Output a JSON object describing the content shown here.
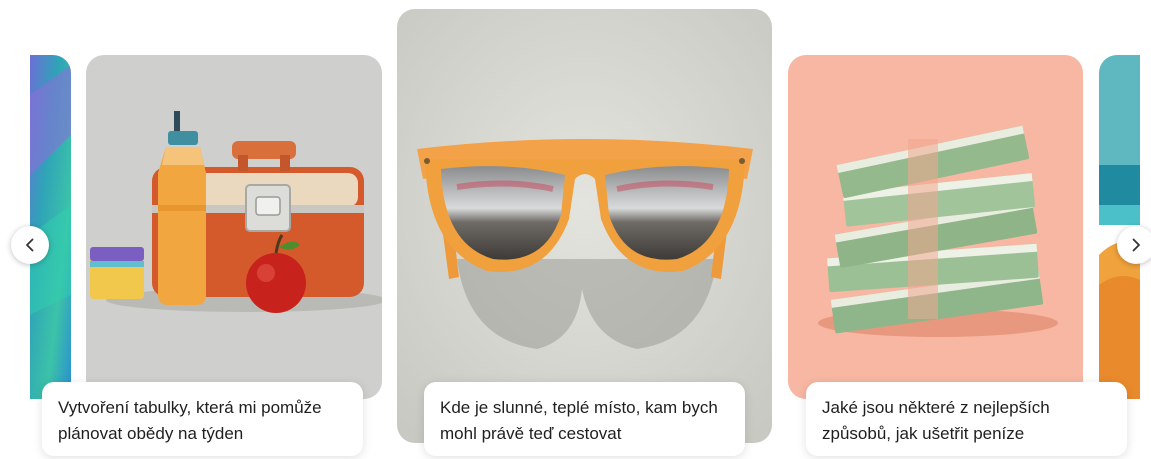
{
  "carousel": {
    "cards": [
      {
        "caption": "Vytvoření tabulky, která mi pomůže plánovat obědy na týden",
        "image": "lunchbox-juice-apple-illustration"
      },
      {
        "caption": "Kde je slunné, teplé místo, kam bych mohl právě teď cestovat",
        "image": "orange-sunglasses-illustration"
      },
      {
        "caption": "Jaké jsou některé z nejlepších způsobů, jak ušetřit peníze",
        "image": "stacks-of-money-illustration"
      }
    ],
    "prev_icon": "chevron-left-icon",
    "next_icon": "chevron-right-icon"
  },
  "colors": {
    "lunch_bg": "#cfd0cd",
    "sun_bg": "#dcdcd7",
    "money_bg": "#f7b7a3",
    "accent_orange": "#f0a03c"
  }
}
